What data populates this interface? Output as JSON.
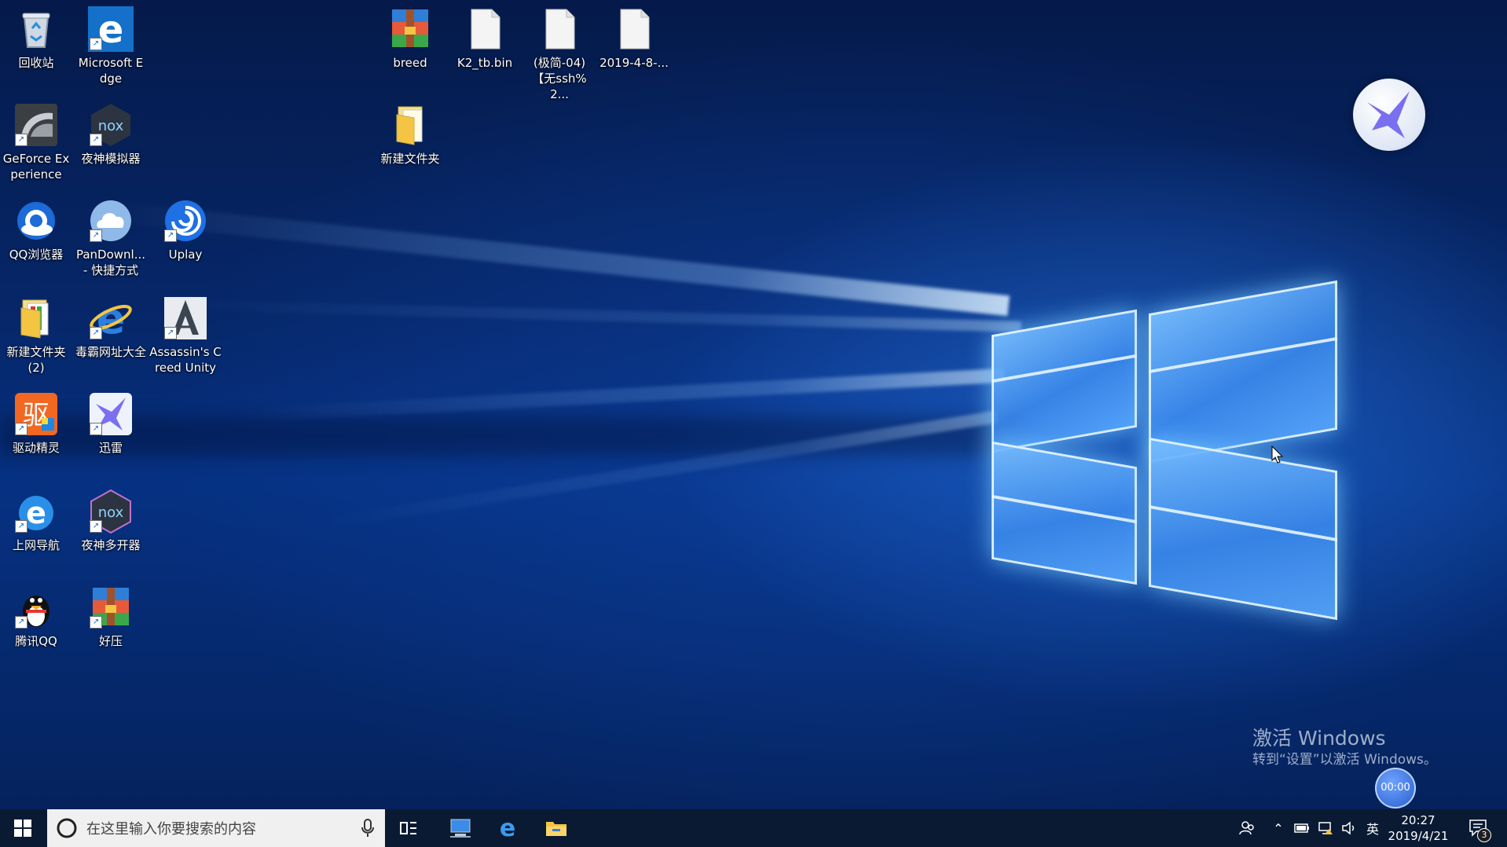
{
  "desktop": {
    "icons": [
      {
        "label": "回收站",
        "icon": "recycle-bin-icon"
      },
      {
        "label": "Microsoft Edge",
        "icon": "edge-icon"
      },
      {
        "label": "GeForce Experience",
        "icon": "geforce-icon"
      },
      {
        "label": "夜神模拟器",
        "icon": "nox-icon"
      },
      {
        "label": "QQ浏览器",
        "icon": "qq-browser-icon"
      },
      {
        "label": "PanDownl... - 快捷方式",
        "icon": "pandownload-icon"
      },
      {
        "label": "Uplay",
        "icon": "uplay-icon"
      },
      {
        "label": "新建文件夹 (2)",
        "icon": "folder-icon"
      },
      {
        "label": "毒霸网址大全",
        "icon": "ie-icon"
      },
      {
        "label": "Assassin's Creed Unity",
        "icon": "assassins-creed-icon"
      },
      {
        "label": "驱动精灵",
        "icon": "driver-genius-icon"
      },
      {
        "label": "迅雷",
        "icon": "thunder-icon"
      },
      {
        "label": "上网导航",
        "icon": "ie-icon"
      },
      {
        "label": "夜神多开器",
        "icon": "nox-icon"
      },
      {
        "label": "腾讯QQ",
        "icon": "qq-penguin-icon"
      },
      {
        "label": "好压",
        "icon": "haozip-icon"
      },
      {
        "label": "breed",
        "icon": "archive-icon"
      },
      {
        "label": "K2_tb.bin",
        "icon": "file-icon"
      },
      {
        "label": "(极简-04)【无ssh%2...",
        "icon": "file-icon"
      },
      {
        "label": "2019-4-8-...",
        "icon": "file-icon"
      },
      {
        "label": "新建文件夹",
        "icon": "folder-icon"
      }
    ],
    "activation": {
      "title": "激活 Windows",
      "subtitle": "转到“设置”以激活 Windows。"
    },
    "recording_timer": "00:00"
  },
  "taskbar": {
    "search_placeholder": "在这里输入你要搜索的内容",
    "ime": "英",
    "clock_time": "20:27",
    "clock_date": "2019/4/21",
    "notification_count": "3"
  },
  "colors": {
    "taskbar_bg": "#0a1a33",
    "edge_blue": "#1570c9",
    "folder_yellow": "#f4c542"
  }
}
